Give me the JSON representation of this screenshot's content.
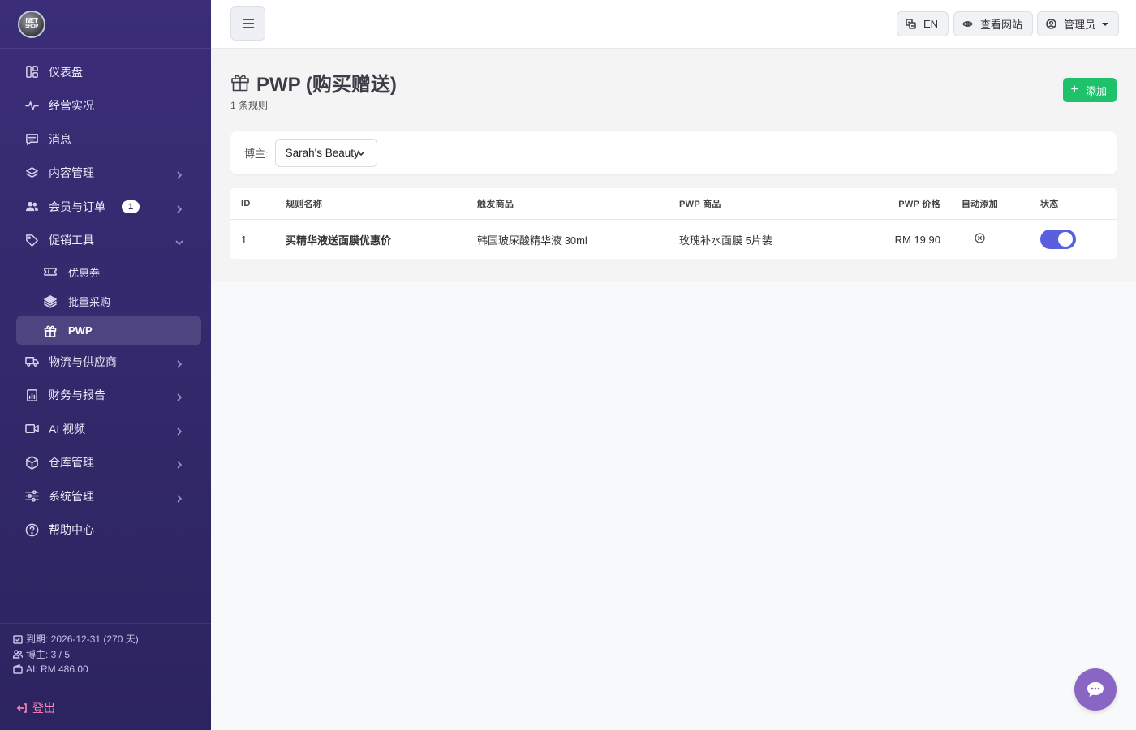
{
  "logo": {
    "line1": "NET",
    "line2": "SHOP"
  },
  "sidebar": {
    "items": [
      {
        "label": "仪表盘",
        "icon": "dashboard-icon"
      },
      {
        "label": "经营实况",
        "icon": "activity-icon"
      },
      {
        "label": "消息",
        "icon": "message-icon"
      },
      {
        "label": "内容管理",
        "icon": "layers-icon"
      },
      {
        "label": "会员与订单",
        "icon": "users-icon",
        "badge": "1"
      },
      {
        "label": "促销工具",
        "icon": "tag-icon"
      },
      {
        "label": "物流与供应商",
        "icon": "truck-icon"
      },
      {
        "label": "财务与报告",
        "icon": "report-icon"
      },
      {
        "label": "AI 视频",
        "icon": "video-icon"
      },
      {
        "label": "仓库管理",
        "icon": "box-icon"
      },
      {
        "label": "系统管理",
        "icon": "sliders-icon"
      },
      {
        "label": "帮助中心",
        "icon": "help-icon"
      }
    ],
    "sub_items": [
      {
        "label": "优惠券",
        "icon": "ticket-icon"
      },
      {
        "label": "批量采购",
        "icon": "stack-icon"
      },
      {
        "label": "PWP",
        "icon": "gift-icon"
      }
    ],
    "footer": {
      "expiry": "到期: 2026-12-31 (270 天)",
      "bloggers": "博主: 3 / 5",
      "ai": "AI: RM 486.00"
    },
    "logout": "登出"
  },
  "header": {
    "lang": "EN",
    "view_site": "查看网站",
    "admin": "管理员"
  },
  "page": {
    "title": "PWP (购买赠送)",
    "subtitle": "1 条规则",
    "add_label": "添加",
    "filter_label": "博主:",
    "filter_value": "Sarah's Beauty"
  },
  "table": {
    "headers": [
      "ID",
      "规则名称",
      "触发商品",
      "PWP 商品",
      "PWP 价格",
      "自动添加",
      "状态"
    ],
    "rows": [
      {
        "id": "1",
        "name": "买精华液送面膜优惠价",
        "trigger": "韩国玻尿酸精华液 30ml",
        "pwp": "玫瑰补水面膜 5片装",
        "price": "RM 19.90",
        "auto_add": false,
        "status": true
      }
    ]
  },
  "colors": {
    "sidebar": "#3b2d78",
    "accent": "#5a5fe0",
    "add": "#1fc16b",
    "chat": "#8a66c4"
  }
}
